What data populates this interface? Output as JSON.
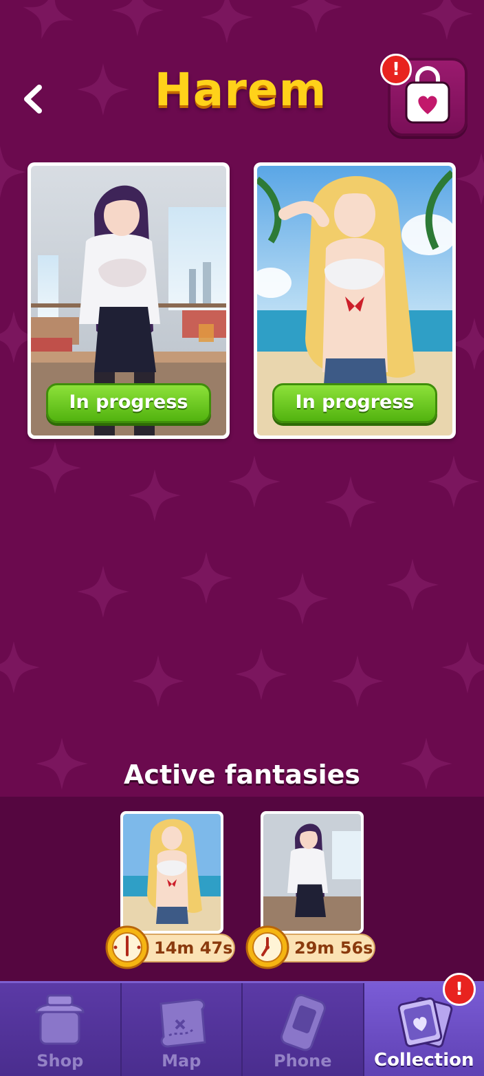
{
  "header": {
    "title": "Harem",
    "bag_alert": "!"
  },
  "cards": [
    {
      "name": "office-girl",
      "status": "In progress"
    },
    {
      "name": "beach-girl",
      "status": "In progress"
    }
  ],
  "fantasies": {
    "title": "Active fantasies",
    "items": [
      {
        "name": "beach-girl",
        "timer": "14m 47s"
      },
      {
        "name": "office-girl",
        "timer": "29m 56s"
      }
    ]
  },
  "nav": {
    "items": [
      {
        "label": "Shop",
        "icon": "shop-icon",
        "active": false
      },
      {
        "label": "Map",
        "icon": "map-icon",
        "active": false
      },
      {
        "label": "Phone",
        "icon": "phone-icon",
        "active": false
      },
      {
        "label": "Collection",
        "icon": "collection-icon",
        "active": true
      }
    ],
    "collection_alert": "!"
  },
  "colors": {
    "background": "#6b0a4e",
    "title": "#ffd21a",
    "progress_button": "#52b30f",
    "nav": "#5b3aa6",
    "alert": "#e8231f"
  }
}
